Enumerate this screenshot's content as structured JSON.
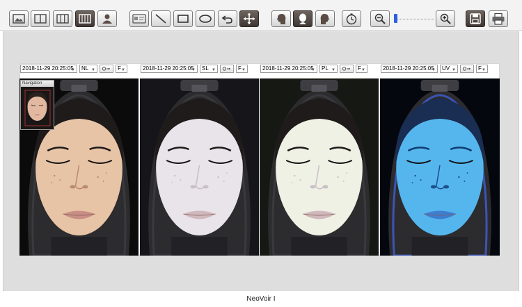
{
  "toolbar": {
    "buttons": [
      {
        "name": "image-icon",
        "dark": false
      },
      {
        "name": "layout-two-panels-icon",
        "dark": false
      },
      {
        "name": "layout-three-panels-icon",
        "dark": false
      },
      {
        "name": "layout-four-panels-icon",
        "dark": true
      },
      {
        "name": "user-profile-icon",
        "dark": false
      },
      {
        "name": "id-card-icon",
        "dark": false
      },
      {
        "name": "line-tool-icon",
        "dark": false
      },
      {
        "name": "rectangle-tool-icon",
        "dark": false
      },
      {
        "name": "ellipse-tool-icon",
        "dark": false
      },
      {
        "name": "undo-icon",
        "dark": false
      },
      {
        "name": "move-tool-icon",
        "dark": true
      },
      {
        "name": "face-left-view-icon",
        "dark": false
      },
      {
        "name": "face-front-view-icon",
        "dark": true
      },
      {
        "name": "face-right-view-icon",
        "dark": false
      },
      {
        "name": "timer-icon",
        "dark": false
      },
      {
        "name": "zoom-out-icon",
        "dark": false
      },
      {
        "name": "zoom-in-icon",
        "dark": false
      },
      {
        "name": "save-icon",
        "dark": true
      },
      {
        "name": "print-icon",
        "dark": false
      }
    ],
    "zoom_level": 0.02
  },
  "panels": [
    {
      "datetime": "2018-11-29 20:25:05",
      "mode": "NL",
      "filter": "F",
      "skin_tone": "#e8c4a6",
      "bg": "#0c0b0b"
    },
    {
      "datetime": "2018-11-29 20:25:05",
      "mode": "SL",
      "filter": "F",
      "skin_tone": "#e9e3ea",
      "bg": "#15151a"
    },
    {
      "datetime": "2018-11-29 20:25:05",
      "mode": "PL",
      "filter": "F",
      "skin_tone": "#eff1e4",
      "bg": "#151813"
    },
    {
      "datetime": "2018-11-29 20:25:05",
      "mode": "UV",
      "filter": "F",
      "skin_tone": "#55b6ee",
      "bg": "#05070f"
    }
  ],
  "navigator": {
    "title": "Navigation"
  },
  "status": {
    "app_name": "NeoVoir I"
  },
  "colors": {
    "accent": "#2e5fe0",
    "toolbar_bg": "#f3f3f3",
    "workspace_bg": "#dedede"
  }
}
